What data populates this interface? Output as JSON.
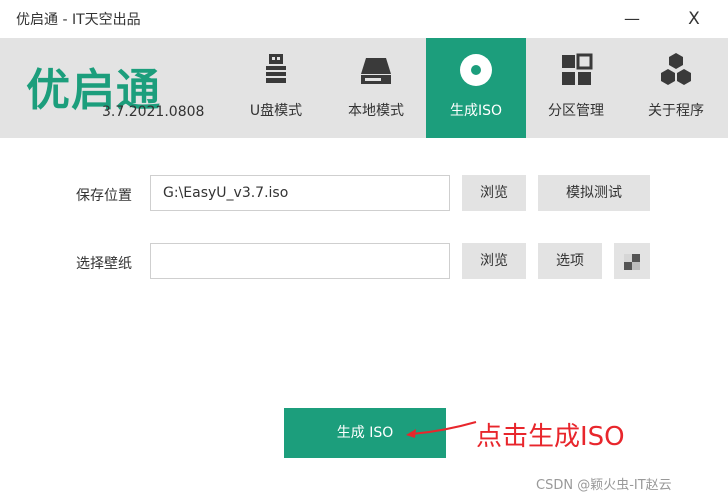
{
  "window": {
    "title": "优启通 - IT天空出品",
    "minimize_glyph": "—",
    "close_glyph": "X"
  },
  "header": {
    "logo_text": "优启通",
    "version": "3.7.2021.0808"
  },
  "nav": {
    "items": [
      {
        "label": "U盘模式",
        "icon": "usb-drive-icon"
      },
      {
        "label": "本地模式",
        "icon": "hard-drive-icon"
      },
      {
        "label": "生成ISO",
        "icon": "disc-icon",
        "active": true
      },
      {
        "label": "分区管理",
        "icon": "partition-grid-icon"
      },
      {
        "label": "关于程序",
        "icon": "hexagons-icon"
      }
    ]
  },
  "form": {
    "save_location": {
      "label": "保存位置",
      "value": "G:\\EasyU_v3.7.iso",
      "browse": "浏览",
      "simulate_test": "模拟测试"
    },
    "wallpaper": {
      "label": "选择壁纸",
      "value": "",
      "browse": "浏览",
      "options": "选项"
    }
  },
  "actions": {
    "generate": "生成 ISO"
  },
  "annotation": {
    "text": "点击生成ISO",
    "color": "#e8262c"
  },
  "watermark": "CSDN @颖火虫-IT赵云",
  "colors": {
    "accent": "#1c9e7c",
    "nav_background": "#e3e3e3"
  }
}
